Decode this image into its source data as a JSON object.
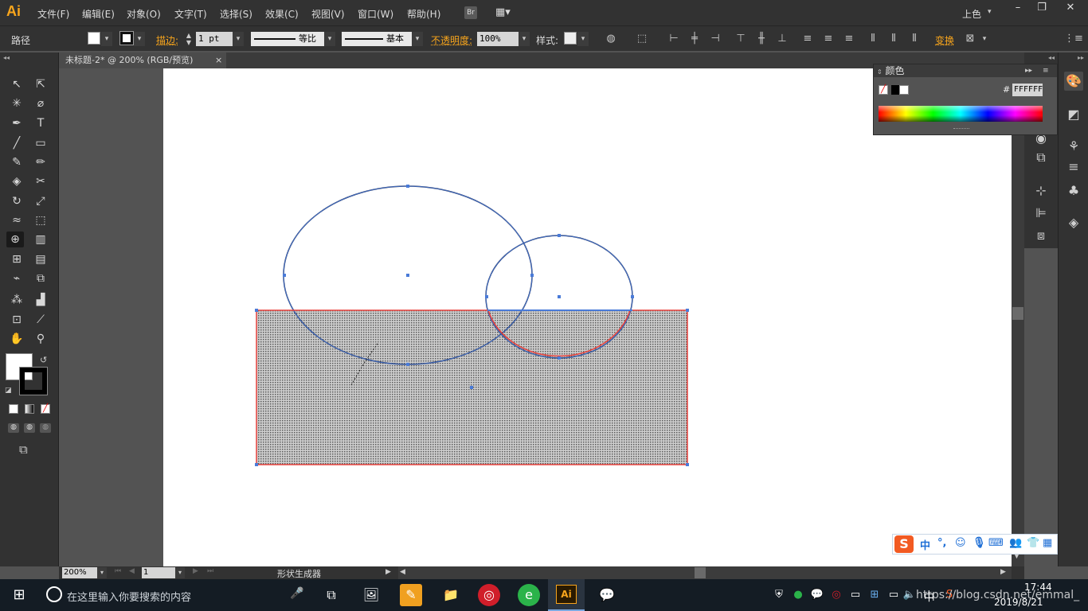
{
  "app": {
    "logo": "Ai"
  },
  "menu": {
    "items": [
      "文件(F)",
      "编辑(E)",
      "对象(O)",
      "文字(T)",
      "选择(S)",
      "效果(C)",
      "视图(V)",
      "窗口(W)",
      "帮助(H)"
    ],
    "bridge_label": "Br",
    "workspace": "上色"
  },
  "control_bar": {
    "selection_type": "路径",
    "stroke_label": "描边:",
    "stroke_weight": "1 pt",
    "profile_label": "等比",
    "brush_label": "基本",
    "opacity_label": "不透明度:",
    "opacity_value": "100%",
    "style_label": "样式:",
    "transform_label": "变换"
  },
  "document": {
    "tab_title": "未标题-2* @ 200% (RGB/预览)",
    "close_symbol": "×"
  },
  "color_panel": {
    "title": "颜色",
    "hash": "#",
    "hex_value": "FFFFFF"
  },
  "status_bar": {
    "zoom": "200%",
    "artboard_number": "1",
    "current_tool": "形状生成器"
  },
  "ime": {
    "logo": "S",
    "mode": "中",
    "punct": "°,"
  },
  "taskbar": {
    "search_placeholder": "在这里输入你要搜索的内容",
    "time": "17:44",
    "date": "2019/8/21",
    "tray_lang": "中",
    "watermark": "https://blog.csdn.net/emmal_"
  },
  "colors": {
    "ui_dark": "#323232",
    "canvas_gray": "#535353",
    "accent_orange": "#f8a51c",
    "selection_blue": "#4a7bd8",
    "highlight_red": "#e8413c",
    "taskbar": "#141c24"
  }
}
